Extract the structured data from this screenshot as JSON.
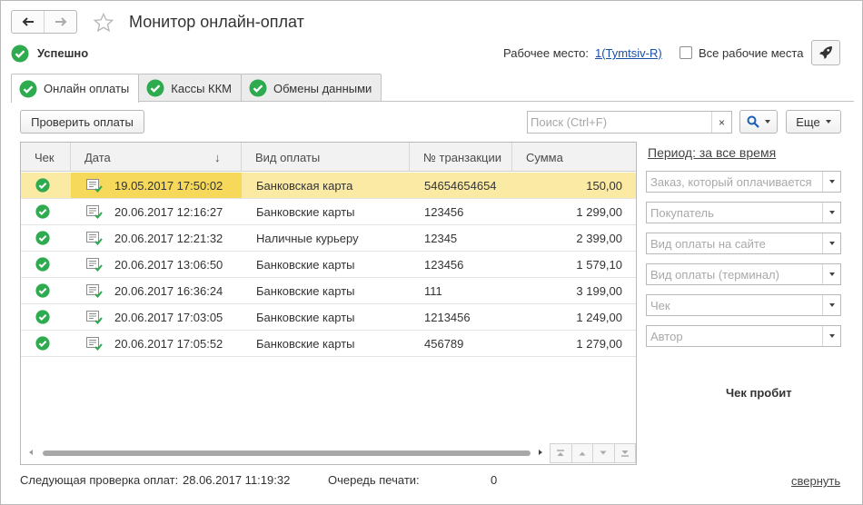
{
  "window": {
    "title": "Монитор онлайн-оплат"
  },
  "status": {
    "text": "Успешно",
    "workplace_label": "Рабочее место:",
    "workplace_value": "1(Tymtsiv-R)",
    "all_workplaces_label": "Все рабочие места",
    "all_workplaces_checked": false
  },
  "tabs": [
    {
      "label": "Онлайн оплаты",
      "active": true,
      "icon": "check-circle-icon"
    },
    {
      "label": "Кассы ККМ",
      "active": false,
      "icon": "check-circle-icon"
    },
    {
      "label": "Обмены данными",
      "active": false,
      "icon": "check-circle-icon"
    }
  ],
  "toolbar": {
    "check_label": "Проверить оплаты",
    "search_placeholder": "Поиск (Ctrl+F)",
    "clear_label": "×",
    "more_label": "Еще"
  },
  "table": {
    "columns": [
      "Чек",
      "Дата",
      "Вид оплаты",
      "№ транзакции",
      "Сумма"
    ],
    "sort_indicator": "↓",
    "rows": [
      {
        "date": "19.05.2017 17:50:02",
        "type": "Банковская карта",
        "txn": "54654654654",
        "amount": "150,00",
        "selected": true
      },
      {
        "date": "20.06.2017 12:16:27",
        "type": "Банковские карты",
        "txn": "123456",
        "amount": "1 299,00",
        "selected": false
      },
      {
        "date": "20.06.2017 12:21:32",
        "type": "Наличные курьеру",
        "txn": "12345",
        "amount": "2 399,00",
        "selected": false
      },
      {
        "date": "20.06.2017 13:06:50",
        "type": "Банковские карты",
        "txn": "123456",
        "amount": "1 579,10",
        "selected": false
      },
      {
        "date": "20.06.2017 16:36:24",
        "type": "Банковские карты",
        "txn": "111",
        "amount": "3 199,00",
        "selected": false
      },
      {
        "date": "20.06.2017 17:03:05",
        "type": "Банковские карты",
        "txn": "1213456",
        "amount": "1 249,00",
        "selected": false
      },
      {
        "date": "20.06.2017 17:05:52",
        "type": "Банковские карты",
        "txn": "456789",
        "amount": "1 279,00",
        "selected": false
      }
    ]
  },
  "filters": {
    "period": "Период: за все время",
    "fields": [
      {
        "placeholder": "Заказ, который оплачивается"
      },
      {
        "placeholder": "Покупатель"
      },
      {
        "placeholder": "Вид оплаты на сайте"
      },
      {
        "placeholder": "Вид оплаты (терминал)"
      },
      {
        "placeholder": "Чек"
      },
      {
        "placeholder": "Автор"
      }
    ],
    "receipt_status": "Чек пробит"
  },
  "footer": {
    "next_check_label": "Следующая проверка оплат:",
    "next_check_value": "28.06.2017 11:19:32",
    "queue_label": "Очередь печати:",
    "queue_value": "0",
    "collapse_label": "свернуть"
  },
  "colors": {
    "success_green": "#2eaa4f",
    "selected_row": "#fbeaa4",
    "selected_cell": "#f6d95a",
    "link_blue": "#1a4fa8"
  }
}
